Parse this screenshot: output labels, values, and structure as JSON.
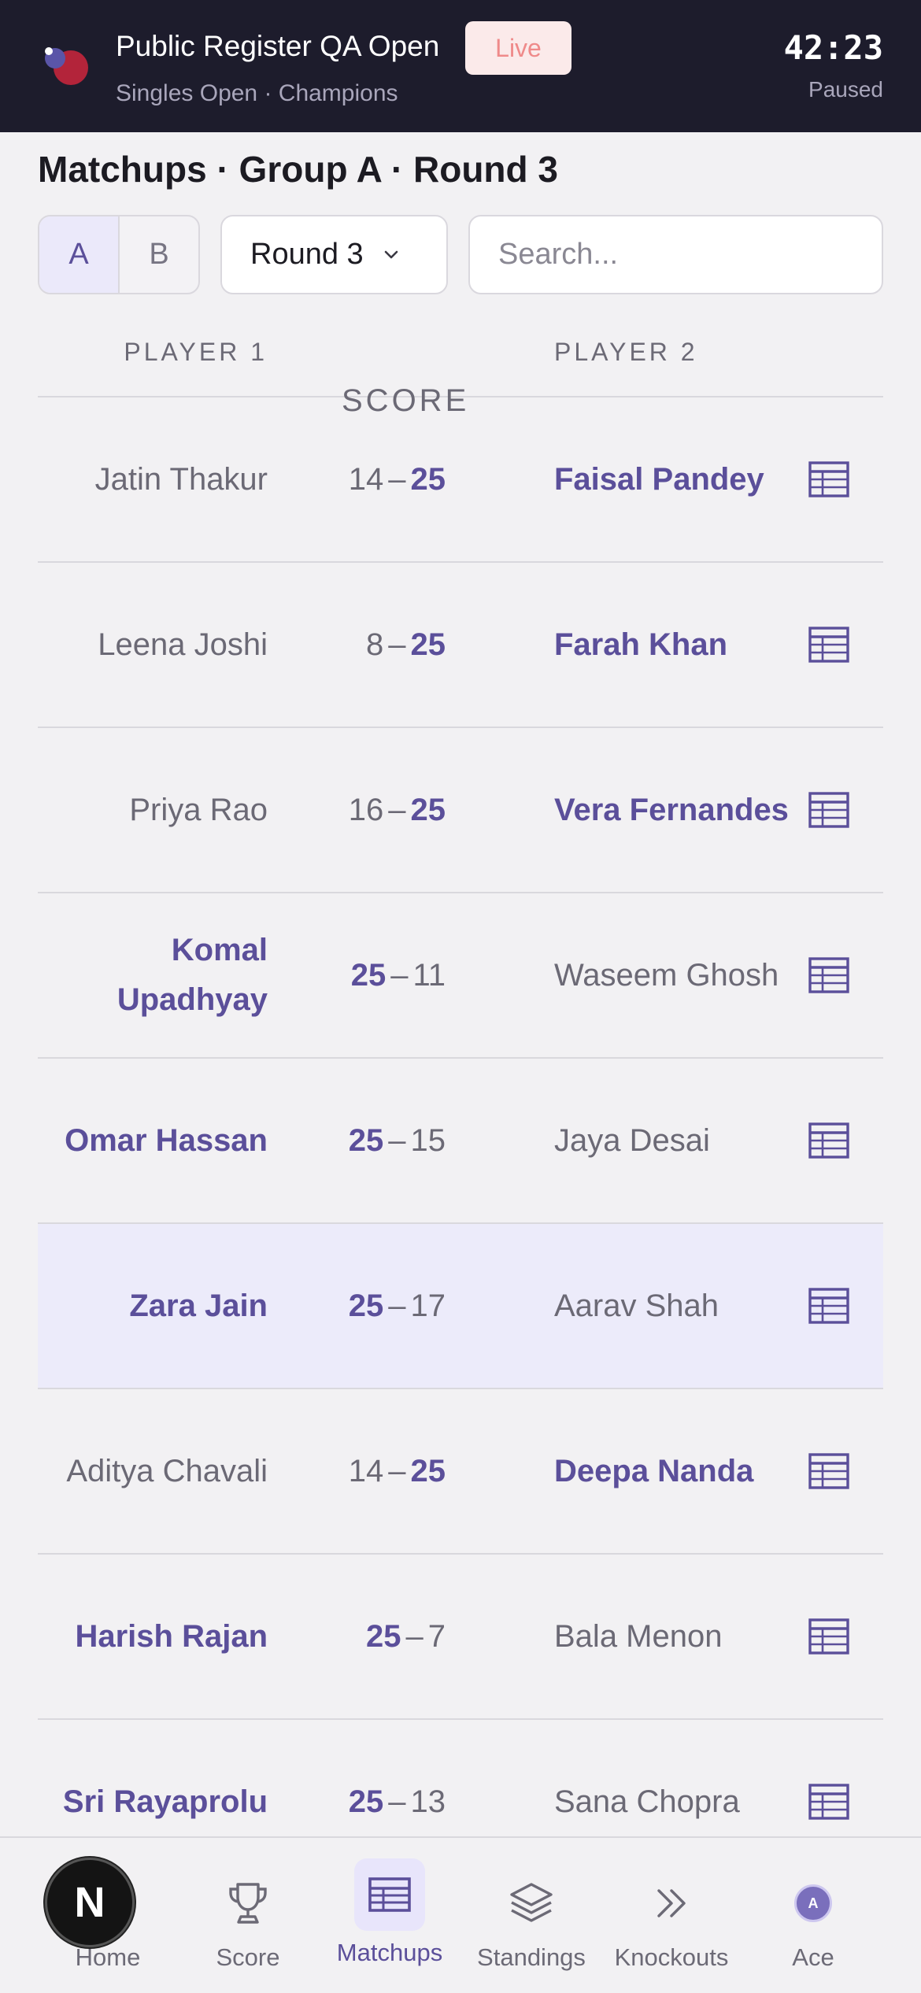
{
  "header": {
    "title": "Public Register QA Open",
    "subtitle": "Singles Open · Champions",
    "live_label": "Live",
    "timer": "42:23",
    "timer_status": "Paused"
  },
  "page": {
    "title": "Matchups · Group A · Round 3"
  },
  "controls": {
    "groups": [
      "A",
      "B"
    ],
    "selected_group": "A",
    "round_select": "Round 3",
    "search_placeholder": "Search..."
  },
  "table": {
    "headers": {
      "player1": "PLAYER 1",
      "score": "SCORE",
      "player2": "PLAYER 2"
    },
    "rows": [
      {
        "p1": "Jatin Thakur",
        "s1": "14",
        "s2": "25",
        "p2": "Faisal Pandey",
        "winner": 2,
        "highlight": false
      },
      {
        "p1": "Leena Joshi",
        "s1": "8",
        "s2": "25",
        "p2": "Farah Khan",
        "winner": 2,
        "highlight": false
      },
      {
        "p1": "Priya Rao",
        "s1": "16",
        "s2": "25",
        "p2": "Vera Fernandes",
        "winner": 2,
        "highlight": false
      },
      {
        "p1": "Komal Upadhyay",
        "s1": "25",
        "s2": "11",
        "p2": "Waseem Ghosh",
        "winner": 1,
        "highlight": false
      },
      {
        "p1": "Omar Hassan",
        "s1": "25",
        "s2": "15",
        "p2": "Jaya Desai",
        "winner": 1,
        "highlight": false
      },
      {
        "p1": "Zara Jain",
        "s1": "25",
        "s2": "17",
        "p2": "Aarav Shah",
        "winner": 1,
        "highlight": true
      },
      {
        "p1": "Aditya Chavali",
        "s1": "14",
        "s2": "25",
        "p2": "Deepa Nanda",
        "winner": 2,
        "highlight": false
      },
      {
        "p1": "Harish Rajan",
        "s1": "25",
        "s2": "7",
        "p2": "Bala Menon",
        "winner": 1,
        "highlight": false
      },
      {
        "p1": "Sri Rayaprolu",
        "s1": "25",
        "s2": "13",
        "p2": "Sana Chopra",
        "winner": 1,
        "highlight": false
      }
    ],
    "row_icon": "table-icon"
  },
  "nav": {
    "items": [
      {
        "label": "Home",
        "icon": "home-icon"
      },
      {
        "label": "Score",
        "icon": "trophy-icon"
      },
      {
        "label": "Matchups",
        "icon": "table-icon",
        "active": true
      },
      {
        "label": "Standings",
        "icon": "layers-icon"
      },
      {
        "label": "Knockouts",
        "icon": "double-chevron-icon"
      },
      {
        "label": "Ace",
        "icon": "avatar-icon",
        "avatar_text": "A"
      }
    ]
  },
  "colors": {
    "accent": "#5b4f9a",
    "header_bg": "#1d1c2c",
    "live_bg": "#fbeaea",
    "live_text": "#ef8a8a",
    "highlight_row": "#ecebfa"
  }
}
